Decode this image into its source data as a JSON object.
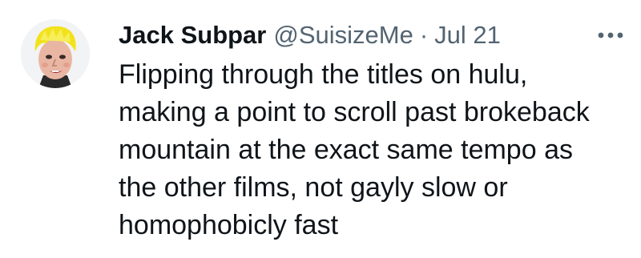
{
  "tweet": {
    "author": {
      "display_name": "Jack Subpar",
      "handle": "@SuisizeMe",
      "avatar_icon": "profile-avatar"
    },
    "separator": "·",
    "date": "Jul 21",
    "more_icon": "more-options-icon",
    "text_lines": [
      "Flipping through the titles on hulu,",
      "making a point to scroll past brokeback",
      "mountain at the exact same tempo as",
      "the other films, not gayly slow or",
      "homophobicly fast"
    ]
  },
  "colors": {
    "primary_text": "#0f1419",
    "secondary_text": "#536471",
    "background": "#ffffff"
  }
}
